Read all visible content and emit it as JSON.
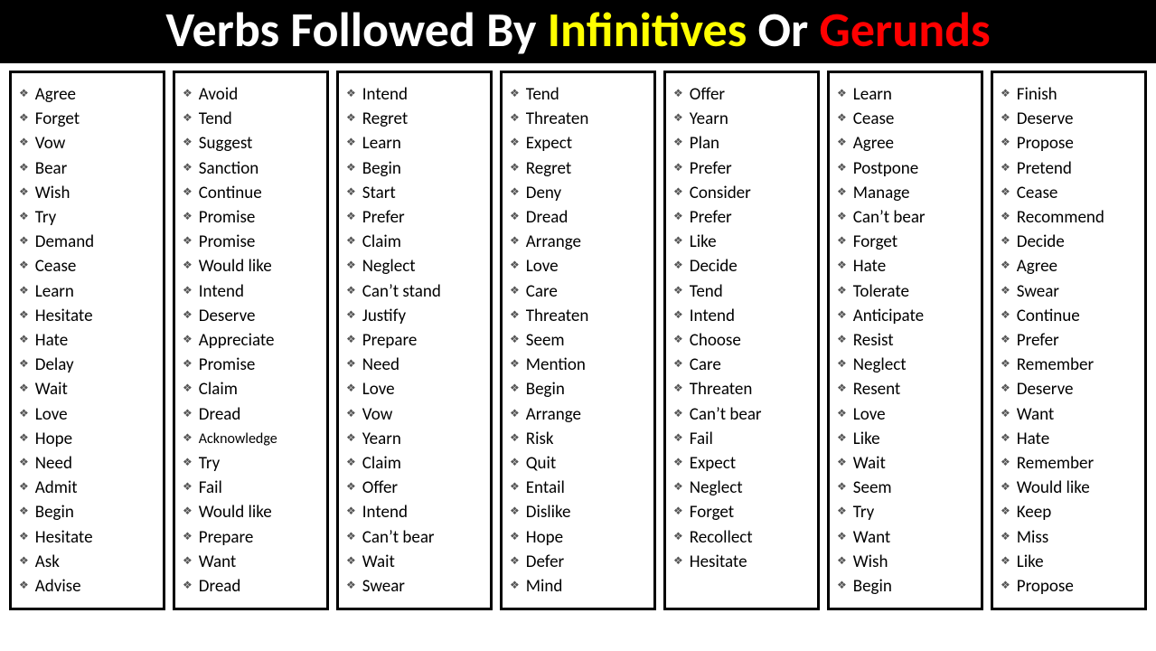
{
  "title": {
    "part1": "Verbs Followed By ",
    "part2": "Infinitives ",
    "part3": "Or ",
    "part4": "Gerunds"
  },
  "columns": [
    {
      "items": [
        "Agree",
        "Forget",
        "Vow",
        "Bear",
        "Wish",
        "Try",
        "Demand",
        "Cease",
        "Learn",
        "Hesitate",
        "Hate",
        "Delay",
        "Wait",
        "Love",
        "Hope",
        "Need",
        "Admit",
        "Begin",
        "Hesitate",
        "Ask",
        "Advise"
      ]
    },
    {
      "items": [
        "Avoid",
        "Tend",
        "Suggest",
        "Sanction",
        "Continue",
        "Promise",
        "Promise",
        "Would like",
        "Intend",
        "Deserve",
        "Appreciate",
        "Promise",
        "Claim",
        "Dread",
        "Acknowledge",
        "Try",
        "Fail",
        "Would like",
        "Prepare",
        "Want",
        "Dread"
      ]
    },
    {
      "items": [
        "Intend",
        "Regret",
        "Learn",
        "Begin",
        "Start",
        "Prefer",
        "Claim",
        "Neglect",
        "Can’t stand",
        "Justify",
        "Prepare",
        "Need",
        "Love",
        "Vow",
        "Yearn",
        "Claim",
        "Offer",
        "Intend",
        "Can’t bear",
        "Wait",
        "Swear"
      ]
    },
    {
      "items": [
        "Tend",
        "Threaten",
        "Expect",
        "Regret",
        "Deny",
        "Dread",
        "Arrange",
        "Love",
        "Care",
        "Threaten",
        "Seem",
        "Mention",
        "Begin",
        "Arrange",
        "Risk",
        "Quit",
        "Entail",
        "Dislike",
        "Hope",
        "Defer",
        "Mind"
      ]
    },
    {
      "items": [
        "Offer",
        "Yearn",
        "Plan",
        "Prefer",
        "Consider",
        "Prefer",
        "Like",
        "Decide",
        "Tend",
        "Intend",
        "Choose",
        "Care",
        "Threaten",
        "Can’t bear",
        "Fail",
        "Expect",
        "Neglect",
        "Forget",
        "Recollect",
        "Hesitate"
      ]
    },
    {
      "items": [
        "Learn",
        "Cease",
        "Agree",
        "Postpone",
        "Manage",
        "Can’t bear",
        "Forget",
        "Hate",
        "Tolerate",
        "Anticipate",
        "Resist",
        "Neglect",
        "Resent",
        "Love",
        "Like",
        "Wait",
        "Seem",
        "Try",
        "Want",
        "Wish",
        "Begin"
      ]
    },
    {
      "items": [
        "Finish",
        "Deserve",
        "Propose",
        "Pretend",
        "Cease",
        "Recommend",
        "Decide",
        "Agree",
        "Swear",
        "Continue",
        "Prefer",
        "Remember",
        "Deserve",
        "Want",
        "Hate",
        "Remember",
        "Would like",
        "Keep",
        "Miss",
        "Like",
        "Propose"
      ]
    }
  ]
}
